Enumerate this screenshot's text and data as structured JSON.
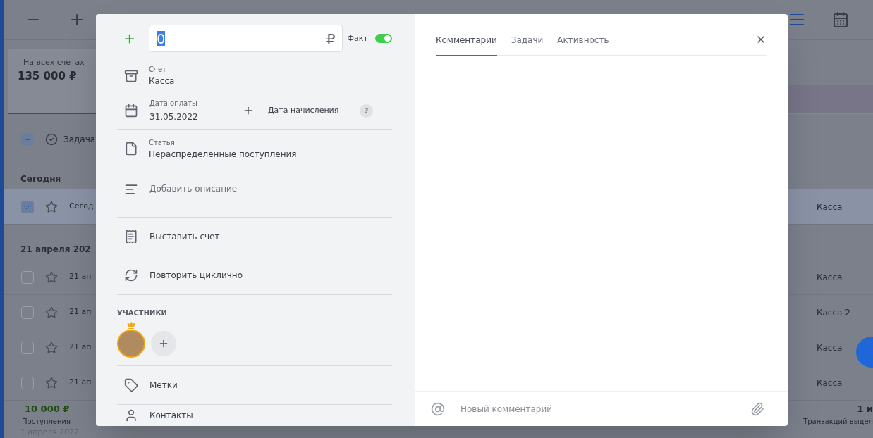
{
  "background": {
    "balance_card": {
      "label": "На всех счетах",
      "amount": "135 000 ₽"
    },
    "toolbar": {
      "select_all_checked": true,
      "task_label": "Задача"
    },
    "groups": [
      {
        "title": "Сегодня",
        "rows": [
          {
            "text": "Сегод",
            "account": "Касса",
            "checked": true
          }
        ]
      },
      {
        "title": "21 апреля 202",
        "rows": [
          {
            "text": "21 ап",
            "account": "Касса",
            "checked": false
          },
          {
            "text": "21 ап",
            "account": "Касса 2",
            "checked": false
          },
          {
            "text": "21 ап",
            "account": "Касса",
            "checked": false
          },
          {
            "text": "21 ап",
            "account": "Касса",
            "checked": false
          }
        ]
      }
    ],
    "footer": {
      "income_amount": "10 000 ₽",
      "income_label": "Поступления",
      "next_group": "1 апреля 2022",
      "selected_count": "1 и",
      "selected_label": "Транзакций выдел"
    }
  },
  "form": {
    "amount": {
      "value": "0",
      "currency": "₽"
    },
    "fact": {
      "label": "Факт",
      "on": true
    },
    "account": {
      "label": "Счет",
      "value": "Касса"
    },
    "payment_date": {
      "label": "Дата оплаты",
      "value": "31.05.2022"
    },
    "accrual_date": {
      "label": "Дата начисления",
      "help": "?"
    },
    "category": {
      "label": "Статья",
      "value": "Нераспределенные поступления"
    },
    "description": {
      "placeholder": "Добавить описание"
    },
    "actions": [
      {
        "kind": "invoice",
        "label": "Выставить счет"
      },
      {
        "kind": "repeat",
        "label": "Повторить циклично"
      }
    ],
    "participants": {
      "title": "УЧАСТНИКИ"
    },
    "links": [
      {
        "kind": "tags",
        "label": "Метки"
      },
      {
        "kind": "contacts",
        "label": "Контакты"
      }
    ]
  },
  "comments": {
    "tabs": [
      {
        "label": "Комментарии",
        "selected": true
      },
      {
        "label": "Задачи",
        "selected": false
      },
      {
        "label": "Активность",
        "selected": false
      }
    ],
    "input": {
      "placeholder": "Новый комментарий"
    }
  }
}
